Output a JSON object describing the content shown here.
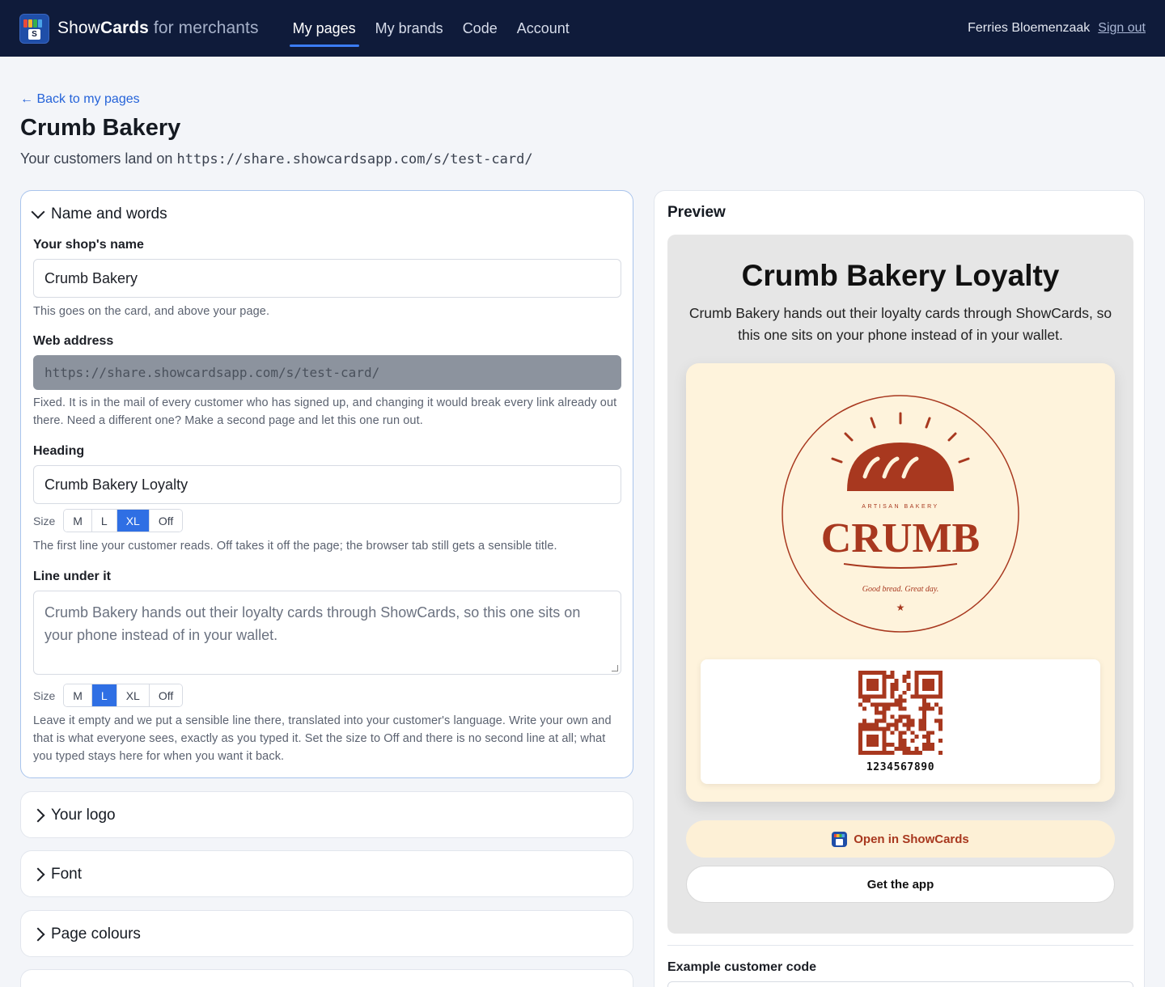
{
  "topbar": {
    "brand_show": "Show",
    "brand_cards": "Cards",
    "brand_sub": "for merchants",
    "nav": [
      {
        "label": "My pages",
        "active": true
      },
      {
        "label": "My brands",
        "active": false
      },
      {
        "label": "Code",
        "active": false
      },
      {
        "label": "Account",
        "active": false
      }
    ],
    "user_name": "Ferries Bloemenzaak",
    "signout_label": "Sign out"
  },
  "header": {
    "back_label": "← Back to my pages",
    "title": "Crumb Bakery",
    "subtitle_prefix": "Your customers land on",
    "subtitle_url": "https://share.showcardsapp.com/s/test-card/"
  },
  "name_panel": {
    "title": "Name and words",
    "shop_name_label": "Your shop's name",
    "shop_name_value": "Crumb Bakery",
    "shop_name_help": "This goes on the card, and above your page.",
    "web_label": "Web address",
    "web_value": "https://share.showcardsapp.com/s/test-card/",
    "web_help": "Fixed. It is in the mail of every customer who has signed up, and changing it would break every link already out there. Need a different one? Make a second page and let this one run out.",
    "heading_label": "Heading",
    "heading_value": "Crumb Bakery Loyalty",
    "size_label": "Size",
    "heading_sizes": [
      "M",
      "L",
      "XL",
      "Off"
    ],
    "heading_size_selected": "XL",
    "heading_help": "The first line your customer reads. Off takes it off the page; the browser tab still gets a sensible title.",
    "line_label": "Line under it",
    "line_value": "Crumb Bakery hands out their loyalty cards through ShowCards, so this one sits on your phone instead of in your wallet.",
    "line_sizes": [
      "M",
      "L",
      "XL",
      "Off"
    ],
    "line_size_selected": "L",
    "line_help": "Leave it empty and we put a sensible line there, translated into your customer's language. Write your own and that is what everyone sees, exactly as you typed it. Set the size to Off and there is no second line at all; what you typed stays here for when you want it back."
  },
  "collapsed_panels": [
    {
      "title": "Your logo"
    },
    {
      "title": "Font"
    },
    {
      "title": "Page colours"
    }
  ],
  "preview": {
    "title": "Preview",
    "heading": "Crumb Bakery Loyalty",
    "line": "Crumb Bakery hands out their loyalty cards through ShowCards, so this one sits on your phone instead of in your wallet.",
    "logo": {
      "small_caps": "ARTISAN BAKERY",
      "wordmark": "CRUMB",
      "tagline": "Good bread. Great day.",
      "color": "#a8381f"
    },
    "card_bg": "#fef3dc",
    "code": "1234567890",
    "open_label": "Open in ShowCards",
    "get_label": "Get the app",
    "example_label": "Example customer code"
  },
  "colors": {
    "nav_bg": "#0f1b3a",
    "accent": "#2f6fe4",
    "brand_red": "#a8381f"
  }
}
